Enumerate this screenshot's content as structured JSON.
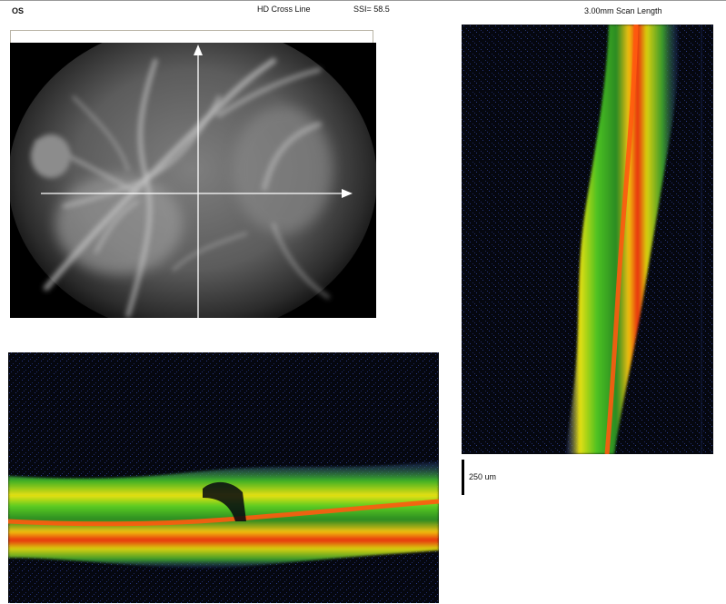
{
  "header": {
    "eye": "OS",
    "scan_type": "HD Cross Line",
    "ssi": "SSI= 58.5",
    "scan_length": "3.00mm Scan Length"
  },
  "scale_bar": {
    "label": "250 um"
  },
  "icons": {
    "vertical_arrow": "arrow-up-icon",
    "horizontal_arrow": "arrow-right-icon"
  },
  "colors": {
    "scan_line": "#ffffff",
    "oct_low": "#1a2a70",
    "oct_mid": "#38c020",
    "oct_high": "#ffe800",
    "oct_peak": "#e83010"
  }
}
